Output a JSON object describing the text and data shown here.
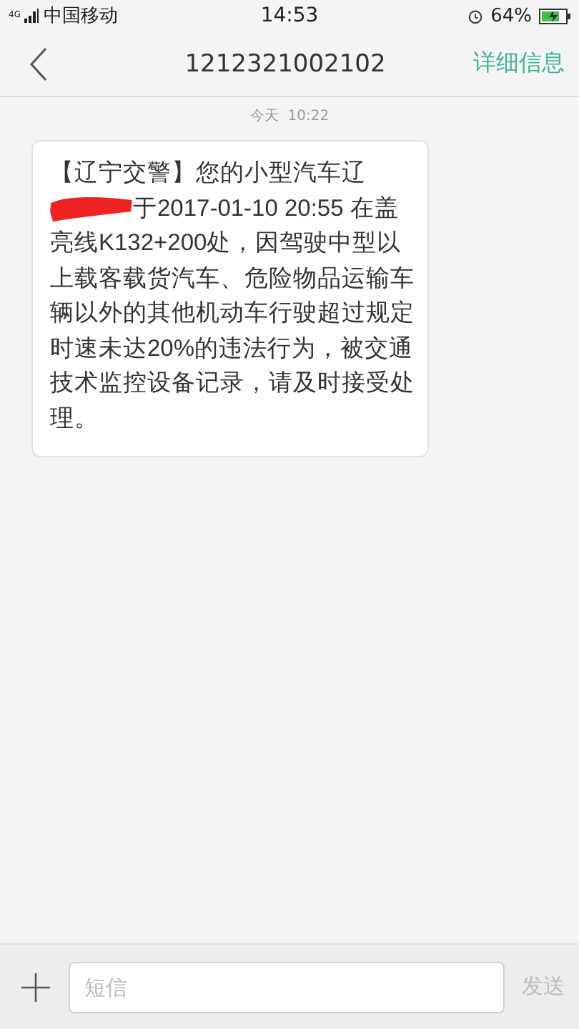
{
  "status_bar": {
    "network": "4G",
    "carrier": "中国移动",
    "time": "14:53",
    "battery": "64%"
  },
  "nav": {
    "title": "1212321002102",
    "action": "详细信息"
  },
  "conversation": {
    "timestamp": "今天  10:22",
    "messages": [
      {
        "text_before": "【辽宁交警】您的小型汽车辽",
        "redacted": true,
        "text_after": "于2017-01-10 20:55 在盖亮线K132+200处，因驾驶中型以上载客载货汽车、危险物品运输车辆以外的其他机动车行驶超过规定时速未达20%的违法行为，被交通技术监控设备记录，请及时接受处理。"
      }
    ]
  },
  "composer": {
    "placeholder": "短信",
    "send": "发送"
  }
}
